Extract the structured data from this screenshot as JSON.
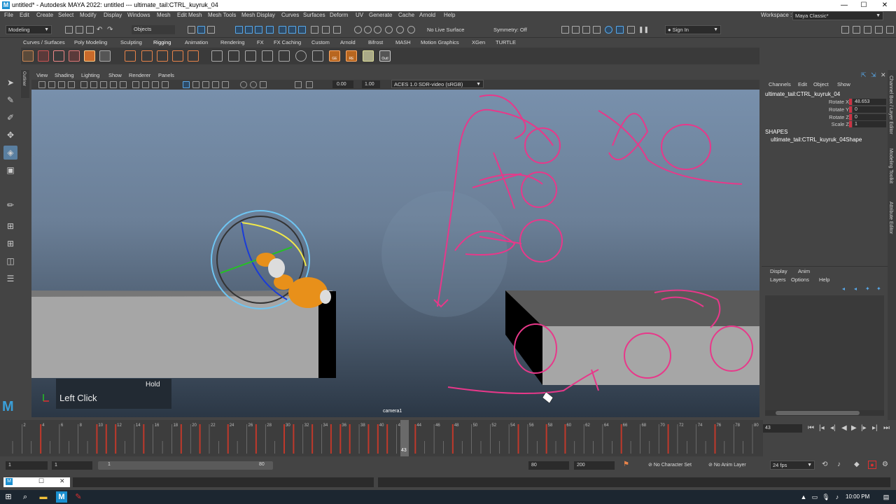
{
  "titlebar": {
    "title": "untitled* - Autodesk MAYA 2022: untitled   ---   ultimate_tail:CTRL_kuyruk_04",
    "logo": "M",
    "minimize": "—",
    "maximize": "☐",
    "close": "✕"
  },
  "menubar": {
    "items": [
      "File",
      "Edit",
      "Create",
      "Select",
      "Modify",
      "Display",
      "Windows",
      "Mesh",
      "Edit Mesh",
      "Mesh Tools",
      "Mesh Display",
      "Curves",
      "Surfaces",
      "Deform",
      "UV",
      "Generate",
      "Cache",
      "Arnold",
      "Help"
    ],
    "workspace_label": "Workspace :",
    "workspace_value": "Maya Classic*"
  },
  "statusline": {
    "mode": "Modeling",
    "objects": "Objects",
    "live_surface": "No Live Surface",
    "symmetry": "Symmetry: Off",
    "sign_in": "Sign In"
  },
  "shelf": {
    "tabs": [
      "Curves / Surfaces",
      "Poly Modeling",
      "Sculpting",
      "Rigging",
      "Animation",
      "Rendering",
      "FX",
      "FX Caching",
      "Custom",
      "Arnold",
      "Bifrost",
      "MASH",
      "Motion Graphics",
      "XGen",
      "TURTLE"
    ],
    "active_tab": "Rigging",
    "icon_labels": {
      "ge": "GE",
      "re": "RE",
      "outl": "Outl"
    }
  },
  "panel": {
    "menus": [
      "View",
      "Shading",
      "Lighting",
      "Show",
      "Renderer",
      "Panels"
    ],
    "field1": "0.00",
    "field2": "1.00",
    "color_space": "ACES 1.0 SDR-video (sRGB)",
    "camera": "camera1",
    "outliner_tab": "Outliner"
  },
  "keyhud": {
    "hold": "Hold",
    "click": "Left Click"
  },
  "channelbox": {
    "menus": [
      "Channels",
      "Edit",
      "Object",
      "Show"
    ],
    "object": "ultimate_tail:CTRL_kuyruk_04",
    "channels": [
      {
        "name": "Rotate X",
        "value": "48.653"
      },
      {
        "name": "Rotate Y",
        "value": "0"
      },
      {
        "name": "Rotate Z",
        "value": "0"
      },
      {
        "name": "Scale Z",
        "value": "1"
      }
    ],
    "shapes_header": "SHAPES",
    "shape_name": "ultimate_tail:CTRL_kuyruk_04Shape"
  },
  "layers": {
    "tabs": [
      "Display",
      "Anim"
    ],
    "menus": [
      "Layers",
      "Options",
      "Help"
    ]
  },
  "sidetabs": [
    "Channel Box / Layer Editor",
    "Modeling Toolkit",
    "Attribute Editor"
  ],
  "timeslider": {
    "ticks": [
      "2",
      "4",
      "6",
      "8",
      "10",
      "12",
      "14",
      "16",
      "18",
      "20",
      "22",
      "24",
      "26",
      "28",
      "30",
      "32",
      "34",
      "36",
      "38",
      "40",
      "42",
      "44",
      "46",
      "48",
      "50",
      "52",
      "54",
      "56",
      "58",
      "60",
      "62",
      "64",
      "66",
      "68",
      "70",
      "72",
      "74",
      "76",
      "78",
      "80"
    ],
    "current": "43",
    "current_field": "43"
  },
  "range": {
    "start": "1",
    "start_inner": "1",
    "range_start": "1",
    "range_end": "80",
    "end_inner": "80",
    "end": "200",
    "character_set": "No Character Set",
    "anim_layer": "No Anim Layer",
    "fps": "24 fps"
  },
  "taskbar": {
    "time": "10:00 PM"
  },
  "colors": {
    "accent": "#58a8e8",
    "annotation": "#e8388a",
    "keyframe": "#c0392b"
  }
}
